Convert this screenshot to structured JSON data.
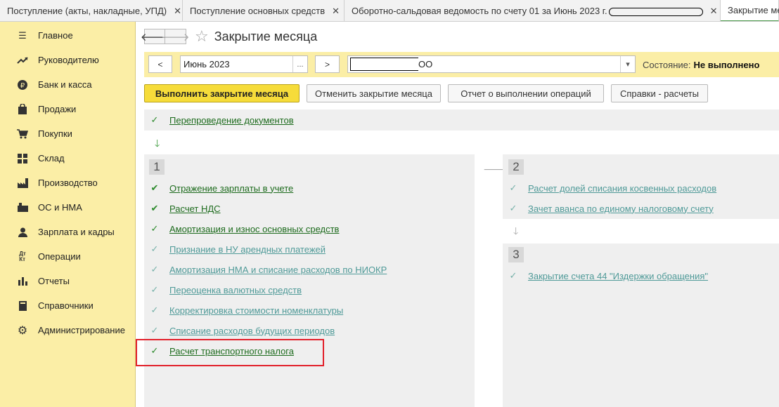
{
  "tabs": [
    {
      "label": "Поступление (акты, накладные, УПД)",
      "width": 260
    },
    {
      "label": "Поступление основных средств",
      "width": 230
    },
    {
      "label": "Оборотно-сальдовая ведомость по счету 01 за Июнь 2023 г.",
      "width": 535
    },
    {
      "label": "Закрытие ме",
      "width": 83
    }
  ],
  "sidebar": {
    "items": [
      {
        "label": "Главное",
        "icon": "menu-icon"
      },
      {
        "label": "Руководителю",
        "icon": "chart-trend-icon"
      },
      {
        "label": "Банк и касса",
        "icon": "ruble-icon"
      },
      {
        "label": "Продажи",
        "icon": "bag-icon"
      },
      {
        "label": "Покупки",
        "icon": "cart-icon"
      },
      {
        "label": "Склад",
        "icon": "grid-icon"
      },
      {
        "label": "Производство",
        "icon": "factory-icon"
      },
      {
        "label": "ОС и НМА",
        "icon": "assets-icon"
      },
      {
        "label": "Зарплата и кадры",
        "icon": "person-icon"
      },
      {
        "label": "Операции",
        "icon": "dt-kt-icon"
      },
      {
        "label": "Отчеты",
        "icon": "bar-chart-icon"
      },
      {
        "label": "Справочники",
        "icon": "book-icon"
      },
      {
        "label": "Администрирование",
        "icon": "gear-icon"
      }
    ]
  },
  "header": {
    "title": "Закрытие месяца"
  },
  "filter": {
    "prev": "<",
    "period": "Июнь 2023",
    "period_select": "...",
    "next": ">",
    "org_suffix": "ОО",
    "dropdown": "▾",
    "status_label": "Состояние:",
    "status_value": "Не выполнено"
  },
  "buttons": {
    "run": "Выполнить закрытие месяца",
    "cancel": "Отменить закрытие месяца",
    "report": "Отчет о выполнении операций",
    "info": "Справки - расчеты"
  },
  "pre_step": {
    "label": "Перепроведение документов",
    "state": "ok"
  },
  "step1": {
    "num": "1",
    "items": [
      {
        "label": "Отражение зарплаты в учете",
        "state": "double"
      },
      {
        "label": "Расчет НДС",
        "state": "double"
      },
      {
        "label": "Амортизация и износ основных средств",
        "state": "ok"
      },
      {
        "label": "Признание в НУ арендных платежей",
        "state": "dim"
      },
      {
        "label": "Амортизация НМА и списание расходов по НИОКР",
        "state": "dim"
      },
      {
        "label": "Переоценка валютных средств",
        "state": "dim"
      },
      {
        "label": "Корректировка стоимости номенклатуры",
        "state": "dim"
      },
      {
        "label": "Списание расходов будущих периодов",
        "state": "dim"
      },
      {
        "label": "Расчет транспортного налога",
        "state": "ok"
      }
    ]
  },
  "step2": {
    "num": "2",
    "items": [
      {
        "label": "Расчет долей списания косвенных расходов",
        "state": "dim"
      },
      {
        "label": "Зачет аванса по единому налоговому счету",
        "state": "dim"
      }
    ]
  },
  "step3": {
    "num": "3",
    "items": [
      {
        "label": "Закрытие счета 44 \"Издержки обращения\"",
        "state": "dim"
      }
    ]
  },
  "colors": {
    "sidebar": "#fbeea6",
    "primary_button": "#f6dc3a",
    "ok_link": "#1d6b1d",
    "dim_link": "#4f9a98",
    "highlight": "#e2202a"
  }
}
